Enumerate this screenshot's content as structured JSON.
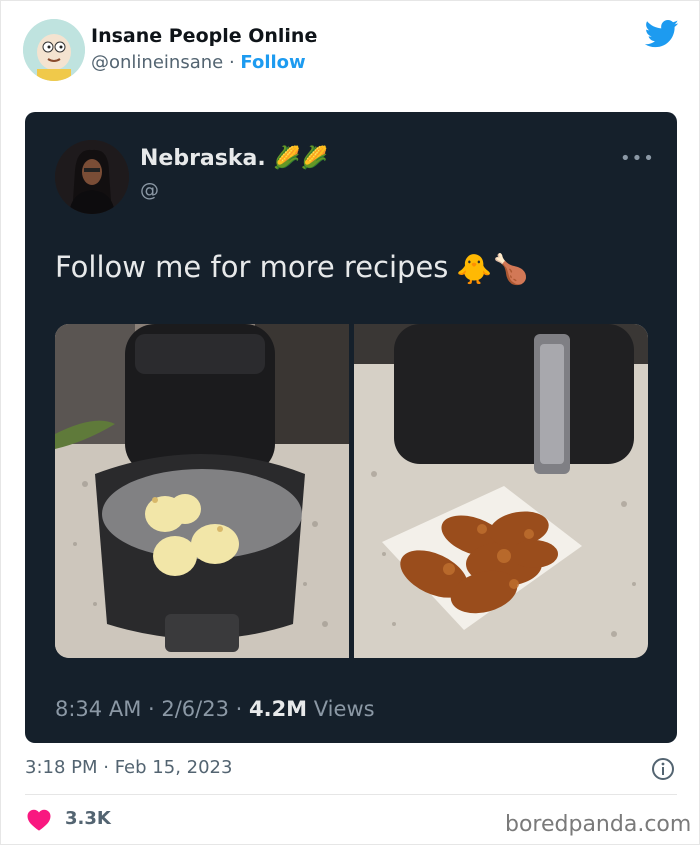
{
  "header": {
    "author_name": "Insane People Online",
    "handle": "@onlineinsane",
    "separator": " · ",
    "follow_label": "Follow",
    "logo_icon": "twitter-bird-icon"
  },
  "embedded_tweet": {
    "name": "Nebraska.",
    "name_emojis": "🌽🌽",
    "at": "@",
    "more_icon": "more-dots-icon",
    "text": "Follow me for more recipes",
    "text_emojis": "🐥🍗",
    "time": "8:34 AM",
    "date": "2/6/23",
    "views_count": "4.2M",
    "views_label": "Views",
    "dot": " · "
  },
  "footer": {
    "timestamp": "3:18 PM · Feb 15, 2023",
    "info_icon": "info-icon",
    "heart_icon": "heart-icon",
    "likes": "3.3K",
    "watermark": "boredpanda.com"
  },
  "colors": {
    "dark_bg": "#15202b",
    "twitter_blue": "#1d9bf0",
    "heart_red": "#f91880",
    "muted": "#536471"
  }
}
